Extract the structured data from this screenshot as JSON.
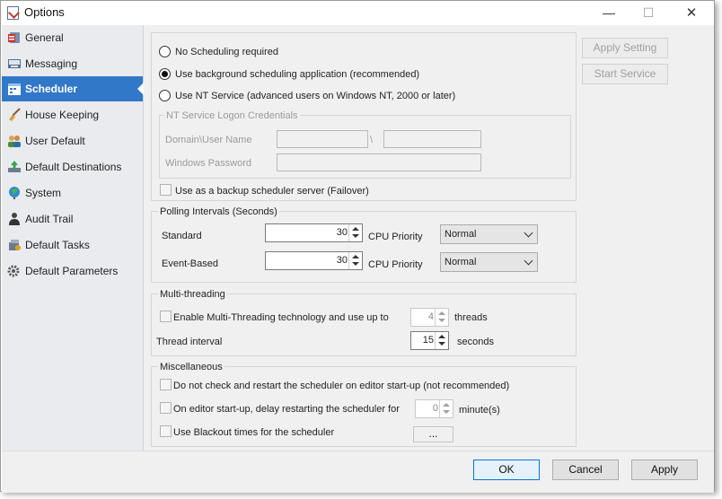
{
  "window": {
    "title": "Options"
  },
  "sidebar": {
    "items": [
      {
        "label": "General",
        "icon": "general-icon",
        "active": false
      },
      {
        "label": "Messaging",
        "icon": "messaging-icon",
        "active": false
      },
      {
        "label": "Scheduler",
        "icon": "scheduler-icon",
        "active": true
      },
      {
        "label": "House Keeping",
        "icon": "broom-icon",
        "active": false
      },
      {
        "label": "User Default",
        "icon": "users-icon",
        "active": false
      },
      {
        "label": "Default Destinations",
        "icon": "destinations-icon",
        "active": false
      },
      {
        "label": "System",
        "icon": "globe-icon",
        "active": false
      },
      {
        "label": "Audit Trail",
        "icon": "audit-icon",
        "active": false
      },
      {
        "label": "Default Tasks",
        "icon": "tasks-icon",
        "active": false
      },
      {
        "label": "Default Parameters",
        "icon": "parameters-icon",
        "active": false
      }
    ]
  },
  "scheduling": {
    "options": [
      {
        "label": "No Scheduling required",
        "checked": false
      },
      {
        "label": "Use background scheduling application (recommended)",
        "checked": true
      },
      {
        "label": "Use NT Service (advanced users on Windows NT, 2000 or later)",
        "checked": false
      }
    ],
    "nt_group_title": "NT Service Logon Credentials",
    "domain_label": "Domain\\User Name",
    "separator": "\\",
    "password_label": "Windows Password",
    "backup_label": "Use as a backup scheduler server (Failover)"
  },
  "side_buttons": {
    "apply_setting": "Apply Setting",
    "start_service": "Start Service"
  },
  "polling": {
    "title": "Polling Intervals (Seconds)",
    "standard_label": "Standard",
    "standard_value": "30",
    "event_label": "Event-Based",
    "event_value": "30",
    "cpu_label": "CPU Priority",
    "cpu_standard": "Normal",
    "cpu_event": "Normal"
  },
  "multithreading": {
    "title": "Multi-threading",
    "enable_label": "Enable Multi-Threading technology and use up to",
    "threads_value": "4",
    "threads_unit": "threads",
    "interval_label": "Thread interval",
    "interval_value": "15",
    "interval_unit": "seconds"
  },
  "misc": {
    "title": "Miscellaneous",
    "no_check_label": "Do not check and restart the scheduler on editor start-up (not recommended)",
    "delay_label": "On editor start-up, delay restarting the scheduler for",
    "delay_value": "0",
    "delay_unit": "minute(s)",
    "blackout_label": "Use Blackout times for the scheduler",
    "ellipsis": "..."
  },
  "footer": {
    "ok": "OK",
    "cancel": "Cancel",
    "apply": "Apply"
  }
}
